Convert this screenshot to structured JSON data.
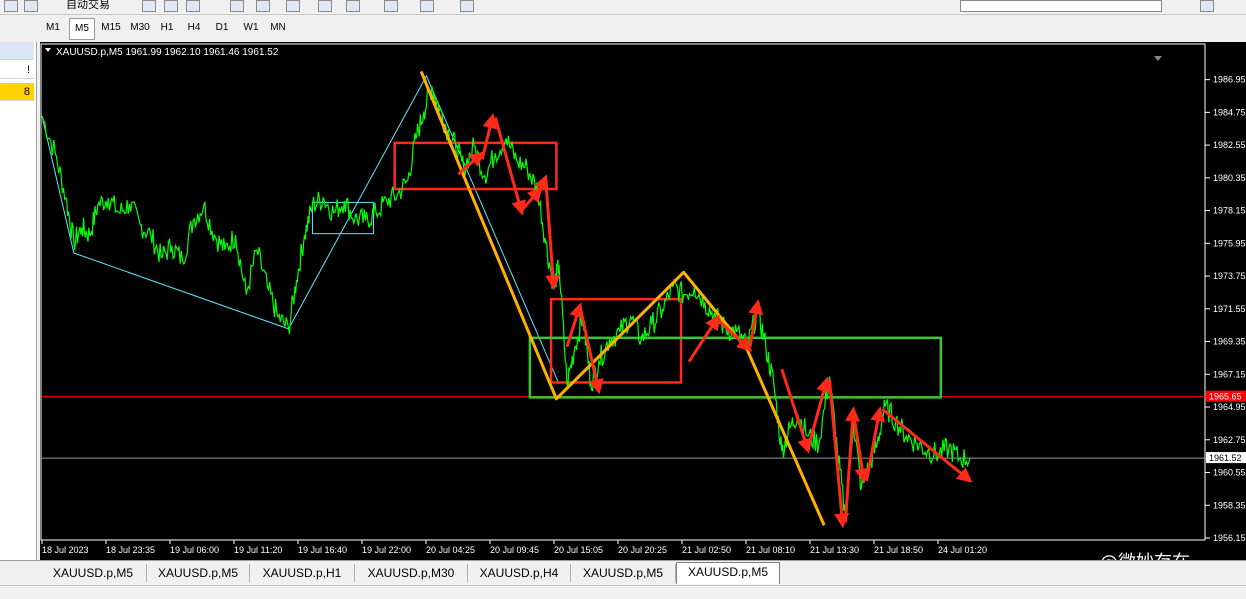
{
  "toolbar": {
    "autotrade_label": "自动交易"
  },
  "timeframes": [
    {
      "label": "M1",
      "active": false
    },
    {
      "label": "M5",
      "active": true
    },
    {
      "label": "M15",
      "active": false
    },
    {
      "label": "M30",
      "active": false
    },
    {
      "label": "H1",
      "active": false
    },
    {
      "label": "H4",
      "active": false
    },
    {
      "label": "D1",
      "active": false
    },
    {
      "label": "W1",
      "active": false
    },
    {
      "label": "MN",
      "active": false
    }
  ],
  "left_panel": {
    "items": [
      "!",
      "8"
    ]
  },
  "chart_header": "XAUUSD.p,M5  1961.99 1962.10 1961.46 1961.52",
  "chart_data": {
    "type": "line",
    "symbol": "XAUUSD.p",
    "timeframe": "M5",
    "ohlc": {
      "open": 1961.99,
      "high": 1962.1,
      "low": 1961.46,
      "close": 1961.52
    },
    "price_ticks": [
      "1986.95",
      "1984.75",
      "1982.55",
      "1980.35",
      "1978.15",
      "1975.95",
      "1973.75",
      "1971.55",
      "1969.35",
      "1967.15",
      "1964.95",
      "1962.75",
      "1960.55",
      "1958.35",
      "1956.15"
    ],
    "time_ticks": [
      "18 Jul 2023",
      "18 Jul 23:35",
      "19 Jul 06:00",
      "19 Jul 11:20",
      "19 Jul 16:40",
      "19 Jul 22:00",
      "20 Jul 04:25",
      "20 Jul 09:45",
      "20 Jul 15:05",
      "20 Jul 20:25",
      "21 Jul 02:50",
      "21 Jul 08:10",
      "21 Jul 13:30",
      "21 Jul 18:50",
      "24 Jul 01:20"
    ],
    "current_price_label": "1961.52",
    "red_line_label": "1965.65",
    "ylim": [
      1956.15,
      1988.0
    ],
    "series_close": [
      [
        0,
        1984.5
      ],
      [
        1.0,
        1982.0
      ],
      [
        1.8,
        1979.0
      ],
      [
        2.4,
        1976.0
      ],
      [
        3.0,
        1977.0
      ],
      [
        3.6,
        1976.5
      ],
      [
        4.2,
        1978.5
      ],
      [
        5.0,
        1979.0
      ],
      [
        5.8,
        1978.0
      ],
      [
        6.6,
        1978.6
      ],
      [
        7.4,
        1977.2
      ],
      [
        8.2,
        1976.5
      ],
      [
        9.0,
        1975.0
      ],
      [
        9.8,
        1975.8
      ],
      [
        10.6,
        1974.8
      ],
      [
        11.4,
        1977.5
      ],
      [
        12.2,
        1978.5
      ],
      [
        13.0,
        1976.5
      ],
      [
        13.8,
        1975.5
      ],
      [
        14.6,
        1976.5
      ],
      [
        15.4,
        1972.5
      ],
      [
        16.2,
        1975.5
      ],
      [
        17.0,
        1973.0
      ],
      [
        17.8,
        1971.0
      ],
      [
        18.6,
        1970.2
      ],
      [
        19.2,
        1973.5
      ],
      [
        19.8,
        1976.5
      ],
      [
        20.4,
        1978.5
      ],
      [
        21.2,
        1979.0
      ],
      [
        22.0,
        1978.0
      ],
      [
        22.8,
        1978.8
      ],
      [
        23.6,
        1977.6
      ],
      [
        24.4,
        1977.5
      ],
      [
        25.2,
        1978.0
      ],
      [
        26.0,
        1978.8
      ],
      [
        26.8,
        1979.2
      ],
      [
        27.6,
        1980.2
      ],
      [
        28.2,
        1983.0
      ],
      [
        28.8,
        1984.8
      ],
      [
        29.4,
        1986.5
      ],
      [
        30.0,
        1985.0
      ],
      [
        30.6,
        1983.5
      ],
      [
        31.2,
        1982.5
      ],
      [
        31.8,
        1981.0
      ],
      [
        32.6,
        1982.5
      ],
      [
        33.4,
        1980.5
      ],
      [
        34.2,
        1982.0
      ],
      [
        35.0,
        1983.0
      ],
      [
        35.8,
        1981.5
      ],
      [
        36.6,
        1981.0
      ],
      [
        37.4,
        1979.5
      ],
      [
        38.0,
        1976.0
      ],
      [
        38.6,
        1973.0
      ],
      [
        39.0,
        1974.5
      ],
      [
        39.6,
        1966.5
      ],
      [
        40.2,
        1969.0
      ],
      [
        40.8,
        1971.0
      ],
      [
        41.4,
        1966.5
      ],
      [
        42.0,
        1968.0
      ],
      [
        42.8,
        1969.5
      ],
      [
        43.6,
        1970.0
      ],
      [
        44.4,
        1971.0
      ],
      [
        45.2,
        1969.5
      ],
      [
        46.0,
        1970.5
      ],
      [
        46.8,
        1971.5
      ],
      [
        47.6,
        1973.0
      ],
      [
        48.4,
        1972.5
      ],
      [
        49.2,
        1973.0
      ],
      [
        50.0,
        1972.0
      ],
      [
        50.8,
        1971.0
      ],
      [
        51.6,
        1970.2
      ],
      [
        52.4,
        1970.0
      ],
      [
        53.2,
        1969.0
      ],
      [
        54.0,
        1971.5
      ],
      [
        54.6,
        1969.0
      ],
      [
        55.2,
        1966.5
      ],
      [
        55.8,
        1962.0
      ],
      [
        56.4,
        1963.5
      ],
      [
        57.0,
        1964.5
      ],
      [
        57.8,
        1963.0
      ],
      [
        58.6,
        1962.5
      ],
      [
        59.4,
        1967.0
      ],
      [
        60.0,
        1962.0
      ],
      [
        60.6,
        1957.5
      ],
      [
        61.2,
        1964.0
      ],
      [
        61.8,
        1959.5
      ],
      [
        62.4,
        1961.0
      ],
      [
        63.0,
        1962.5
      ],
      [
        63.6,
        1965.0
      ],
      [
        64.4,
        1964.0
      ],
      [
        65.2,
        1963.0
      ],
      [
        66.0,
        1962.5
      ],
      [
        66.8,
        1962.0
      ],
      [
        67.6,
        1961.8
      ],
      [
        68.4,
        1962.2
      ],
      [
        69.2,
        1961.5
      ],
      [
        70.0,
        1961.52
      ]
    ],
    "overlays": {
      "cyan_zigzag": [
        [
          0,
          1984.5
        ],
        [
          2.4,
          1975.3
        ],
        [
          18.6,
          1970.2
        ],
        [
          29.0,
          1987.2
        ],
        [
          39.0,
          1966.5
        ]
      ],
      "cyan_box": {
        "x": [
          20.4,
          25.0
        ],
        "y": [
          1976.6,
          1978.7
        ]
      },
      "orange_lines": [
        [
          28.6,
          1987.5
        ],
        [
          31.8,
          1980.5
        ],
        [
          38.8,
          1965.5
        ],
        [
          48.4,
          1974.0
        ],
        [
          53.2,
          1968.8
        ],
        [
          59.0,
          1957.0
        ]
      ],
      "red_boxes": [
        {
          "x": [
            26.6,
            38.8
          ],
          "y": [
            1979.6,
            1982.7
          ]
        },
        {
          "x": [
            38.4,
            48.2
          ],
          "y": [
            1966.6,
            1972.2
          ]
        }
      ],
      "green_box": {
        "x": [
          36.8,
          67.8
        ],
        "y": [
          1965.6,
          1969.6
        ]
      },
      "red_arrows": [
        [
          [
            31.4,
            1980.6
          ],
          [
            33.2,
            1982.0
          ]
        ],
        [
          [
            33.2,
            1981.6
          ],
          [
            34.0,
            1984.5
          ]
        ],
        [
          [
            34.2,
            1984.4
          ],
          [
            36.2,
            1978.0
          ]
        ],
        [
          [
            36.2,
            1978.2
          ],
          [
            37.6,
            1979.6
          ]
        ],
        [
          [
            37.6,
            1979.5
          ],
          [
            38.0,
            1980.4
          ]
        ],
        [
          [
            38.0,
            1980.2
          ],
          [
            38.6,
            1973.0
          ]
        ],
        [
          [
            39.6,
            1969.0
          ],
          [
            40.6,
            1971.8
          ]
        ],
        [
          [
            40.6,
            1971.6
          ],
          [
            42.0,
            1966.0
          ]
        ],
        [
          [
            48.8,
            1968.0
          ],
          [
            51.0,
            1971.0
          ]
        ],
        [
          [
            51.0,
            1970.8
          ],
          [
            53.4,
            1968.8
          ]
        ],
        [
          [
            53.4,
            1969.0
          ],
          [
            54.0,
            1972.0
          ]
        ],
        [
          [
            55.8,
            1967.5
          ],
          [
            57.8,
            1962.0
          ]
        ],
        [
          [
            57.8,
            1962.2
          ],
          [
            59.2,
            1966.8
          ]
        ],
        [
          [
            59.4,
            1966.8
          ],
          [
            60.4,
            1957.0
          ]
        ],
        [
          [
            60.6,
            1957.2
          ],
          [
            61.2,
            1964.8
          ]
        ],
        [
          [
            61.2,
            1964.6
          ],
          [
            62.0,
            1960.0
          ]
        ],
        [
          [
            62.2,
            1960.0
          ],
          [
            63.2,
            1964.8
          ]
        ],
        [
          [
            63.4,
            1964.8
          ],
          [
            70.0,
            1960.0
          ]
        ]
      ]
    }
  },
  "tabs": [
    {
      "label": "XAUUSD.p,M5",
      "active": false
    },
    {
      "label": "XAUUSD.p,M5",
      "active": false
    },
    {
      "label": "XAUUSD.p,H1",
      "active": false
    },
    {
      "label": "XAUUSD.p,M30",
      "active": false
    },
    {
      "label": "XAUUSD.p,H4",
      "active": false
    },
    {
      "label": "XAUUSD.p,M5",
      "active": false
    },
    {
      "label": "XAUUSD.p,M5",
      "active": true
    }
  ],
  "watermark": "@微妙存在",
  "colors": {
    "price_line": "#00ff00",
    "zigzag": "#5fe6ff",
    "orange": "#ffb000",
    "red": "#ff2a1a",
    "green_box": "#36c636",
    "level_line": "#ff0000",
    "current_line": "#9a9a9a"
  }
}
